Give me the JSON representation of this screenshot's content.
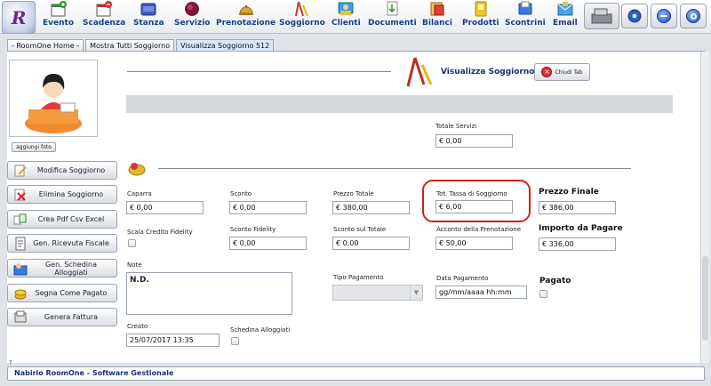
{
  "toolbar": {
    "items": [
      {
        "label": "Evento"
      },
      {
        "label": "Scadenza"
      },
      {
        "label": "Stanza"
      },
      {
        "label": "Servizio"
      },
      {
        "label": "Prenotazione"
      },
      {
        "label": "Soggiorno"
      },
      {
        "label": "Clienti"
      },
      {
        "label": "Documenti"
      },
      {
        "label": "Bilanci"
      },
      {
        "label": "Prodotti"
      },
      {
        "label": "Scontrini"
      },
      {
        "label": "Email"
      }
    ]
  },
  "tabs": [
    {
      "label": "- RoomOne Home -"
    },
    {
      "label": "Mostra Tutti Soggiorno"
    },
    {
      "label": "Visualizza Soggiorno 512"
    }
  ],
  "sidebar": {
    "photo_button": "aggiungi foto",
    "buttons": [
      {
        "label": "Modifica Soggiorno"
      },
      {
        "label": "Elimina Soggiorno"
      },
      {
        "label": "Crea Pdf Csv Excel"
      },
      {
        "label": "Gen. Ricevuta Fiscale"
      },
      {
        "label": "Gen. Schedina Alloggiati"
      },
      {
        "label": "Segna Come Pagato"
      },
      {
        "label": "Genera Fattura"
      }
    ]
  },
  "header": {
    "title": "Visualizza Soggiorno",
    "close_label": "Chiudi Tab"
  },
  "form": {
    "totale_servizi": {
      "label": "Totale Servizi",
      "value": "€ 0,00"
    },
    "caparra": {
      "label": "Caparra",
      "value": "€ 0,00"
    },
    "sconto": {
      "label": "Sconto",
      "value": "€ 0,00"
    },
    "prezzo_totale": {
      "label": "Prezzo Totale",
      "value": "€ 380,00"
    },
    "tassa_soggiorno": {
      "label": "Tot. Tassa di Soggiorno",
      "value": "€ 6,00"
    },
    "prezzo_finale": {
      "label": "Prezzo Finale",
      "value": "€ 386,00"
    },
    "scala_credito": {
      "label": "Scala Credito Fidelity"
    },
    "sconto_fidelity": {
      "label": "Sconto Fidelity",
      "value": "€ 0,00"
    },
    "sconto_totale": {
      "label": "Sconto sul Totale",
      "value": "€ 0,00"
    },
    "acconto": {
      "label": "Acconto della Prenotazione",
      "value": "€ 50,00"
    },
    "importo_pagare": {
      "label": "Importo da Pagare",
      "value": "€ 336,00"
    },
    "note": {
      "label": "Note",
      "value": "N.D."
    },
    "tipo_pagamento": {
      "label": "Tipo Pagamento"
    },
    "data_pagamento": {
      "label": "Data Pagamento",
      "value": "gg/mm/aaaa hh:mm"
    },
    "pagato": {
      "label": "Pagato"
    },
    "creato": {
      "label": "Creato",
      "value": "25/07/2017 13:35"
    },
    "schedina": {
      "label": "Schedina Alloggiati"
    }
  },
  "footer": {
    "question": "?",
    "text": "Nabirio RoomOne - Software Gestionale"
  }
}
